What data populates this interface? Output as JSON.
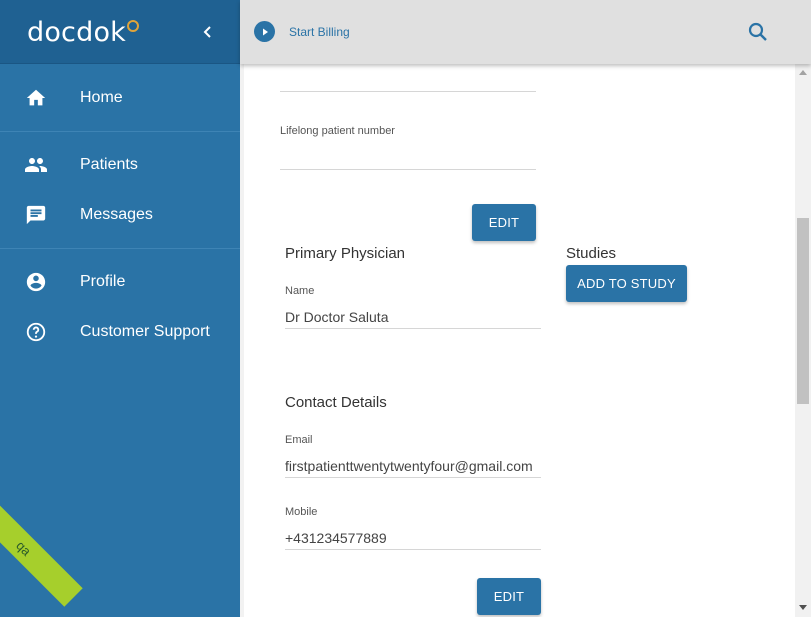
{
  "app": {
    "logo_text": "docdok",
    "env_badge": "qa"
  },
  "sidebar": {
    "items": [
      {
        "label": "Home",
        "icon": "home-icon"
      },
      {
        "label": "Patients",
        "icon": "people-icon"
      },
      {
        "label": "Messages",
        "icon": "message-icon"
      },
      {
        "label": "Profile",
        "icon": "account-circle-icon"
      },
      {
        "label": "Customer Support",
        "icon": "help-circle-icon"
      }
    ]
  },
  "topbar": {
    "start_billing_label": "Start Billing"
  },
  "patient": {
    "lifelong_number_label": "Lifelong patient number",
    "lifelong_number_value": "",
    "edit_label": "EDIT"
  },
  "primary_physician": {
    "title": "Primary Physician",
    "name_label": "Name",
    "name_value": "Dr Doctor Saluta"
  },
  "studies": {
    "title": "Studies",
    "add_label": "ADD TO STUDY"
  },
  "contact": {
    "title": "Contact Details",
    "email_label": "Email",
    "email_value": "firstpatienttwentytwentyfour@gmail.com",
    "mobile_label": "Mobile",
    "mobile_value": "+431234577889",
    "edit_label": "EDIT"
  },
  "colors": {
    "primary": "#2a73a6",
    "sidebar_header": "#1f6192",
    "topbar": "#e0e0e0",
    "env_badge": "#a6cf2c"
  }
}
